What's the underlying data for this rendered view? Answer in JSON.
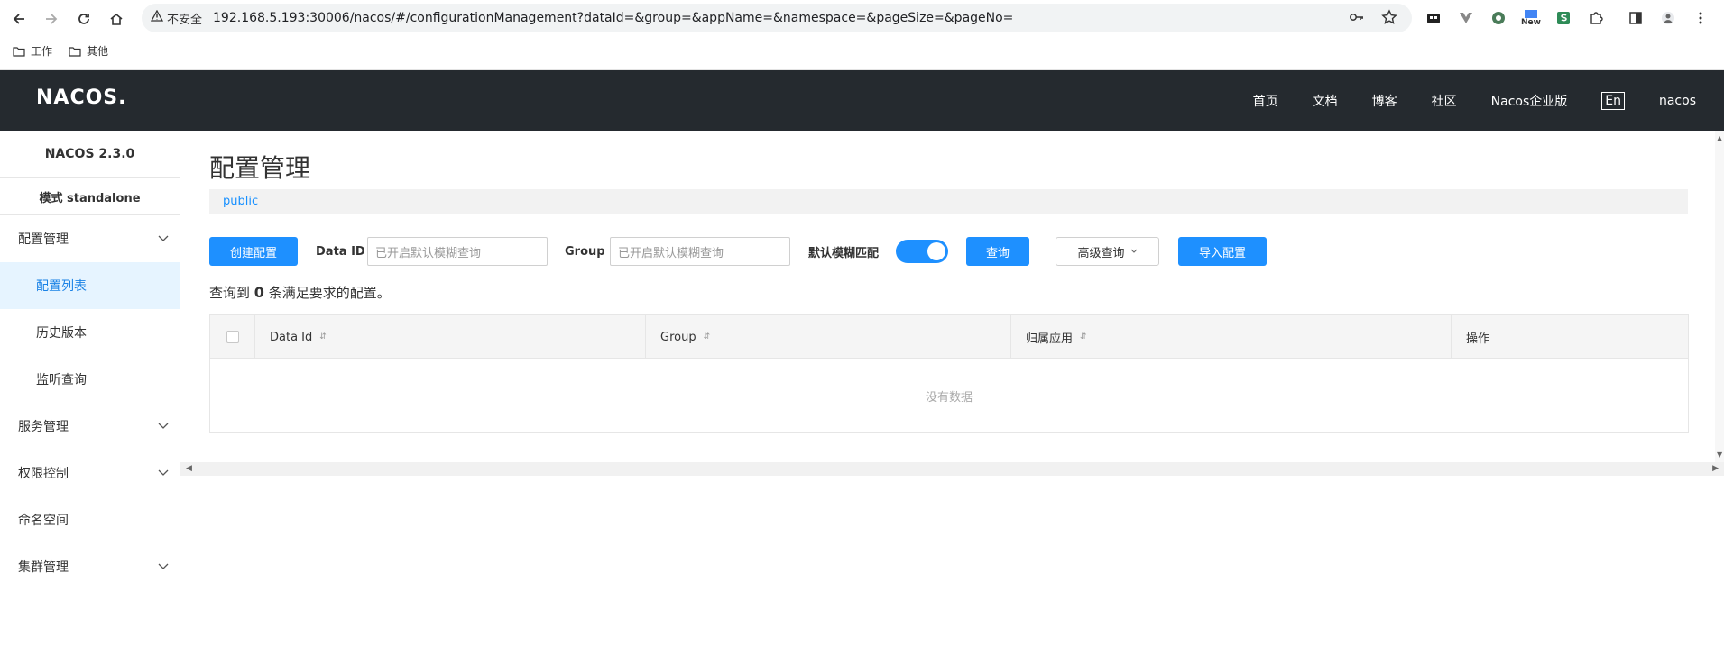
{
  "browser": {
    "security_label": "不安全",
    "url": "192.168.5.193:30006/nacos/#/configurationManagement?dataId=&group=&appName=&namespace=&pageSize=&pageNo=",
    "new_badge": "New",
    "bookmarks": [
      "工作",
      "其他"
    ]
  },
  "header": {
    "logo": "NACOS.",
    "nav": [
      "首页",
      "文档",
      "博客",
      "社区",
      "Nacos企业版"
    ],
    "lang": "En",
    "user": "nacos"
  },
  "sidebar": {
    "version": "NACOS 2.3.0",
    "mode": "模式 standalone",
    "groups": {
      "config": "配置管理",
      "config_items": [
        "配置列表",
        "历史版本",
        "监听查询"
      ],
      "service": "服务管理",
      "auth": "权限控制",
      "namespace": "命名空间",
      "cluster": "集群管理"
    }
  },
  "main": {
    "title": "配置管理",
    "namespace": "public",
    "toolbar": {
      "create": "创建配置",
      "data_id_label": "Data ID",
      "data_id_placeholder": "已开启默认模糊查询",
      "group_label": "Group",
      "group_placeholder": "已开启默认模糊查询",
      "fuzzy_label": "默认模糊匹配",
      "search": "查询",
      "advanced": "高级查询",
      "import": "导入配置"
    },
    "result": {
      "prefix": "查询到",
      "count": "0",
      "suffix": "条满足要求的配置。"
    },
    "table": {
      "columns": [
        "Data Id",
        "Group",
        "归属应用",
        "操作"
      ],
      "empty": "没有数据"
    }
  },
  "colors": {
    "primary": "#1e90ff",
    "header_bg": "#252a2f",
    "active_bg": "#e6f4ff"
  }
}
